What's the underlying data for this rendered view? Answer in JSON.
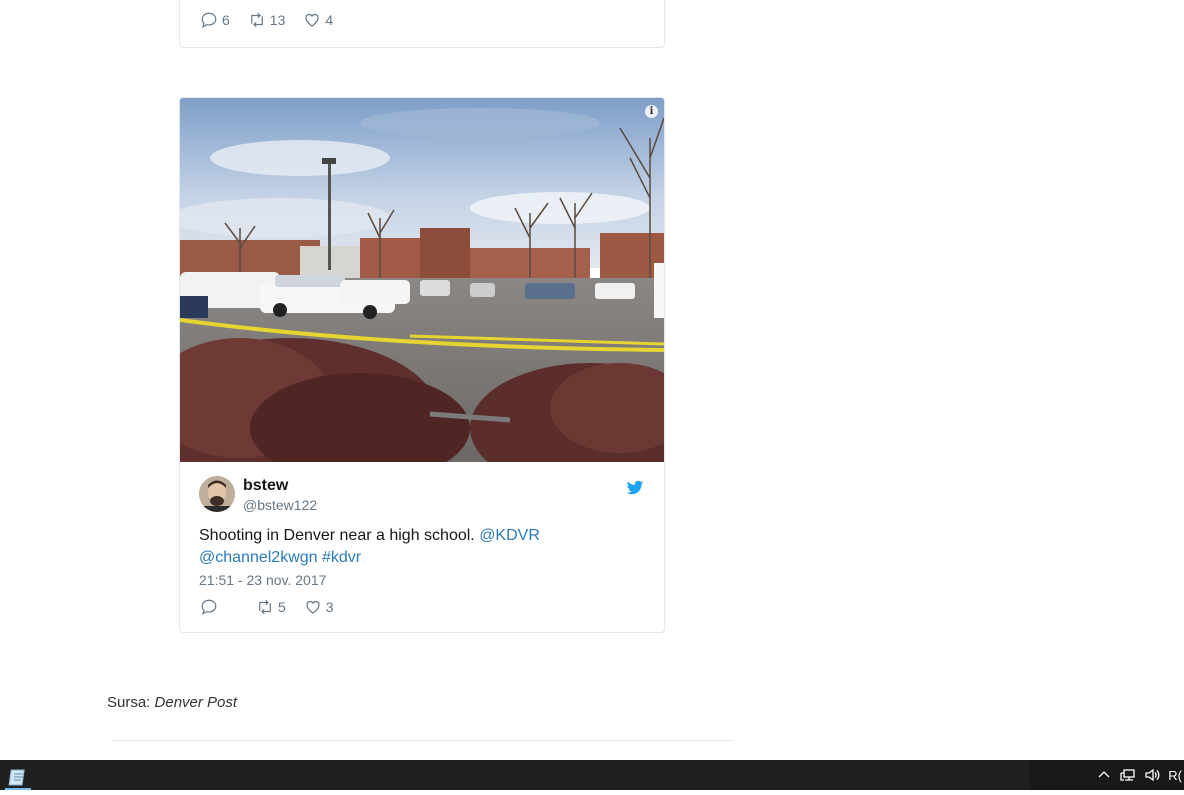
{
  "tweet1": {
    "replies": "6",
    "retweets": "13",
    "likes": "4"
  },
  "tweet2": {
    "display_name": "bstew",
    "handle": "@bstew122",
    "text_plain": "Shooting in Denver near a high school. ",
    "mention1": "@KDVR",
    "mention2": "@channel2kwgn",
    "hashtag": "#kdvr",
    "timestamp": "21:51 - 23 nov. 2017",
    "replies": "",
    "retweets": "5",
    "likes": "3",
    "info_icon": "i"
  },
  "source": {
    "label": "Sursa: ",
    "name": "Denver Post"
  },
  "taskbar": {
    "tray_text": "R("
  },
  "colors": {
    "link": "#2b7bb9",
    "muted": "#657786",
    "twitter_blue": "#1da1f2",
    "taskbar": "#202020"
  },
  "icons": [
    "reply-icon",
    "retweet-icon",
    "like-icon",
    "twitter-bird-icon",
    "info-icon",
    "chevron-up-icon",
    "network-icon",
    "volume-icon",
    "start-app-icon"
  ]
}
